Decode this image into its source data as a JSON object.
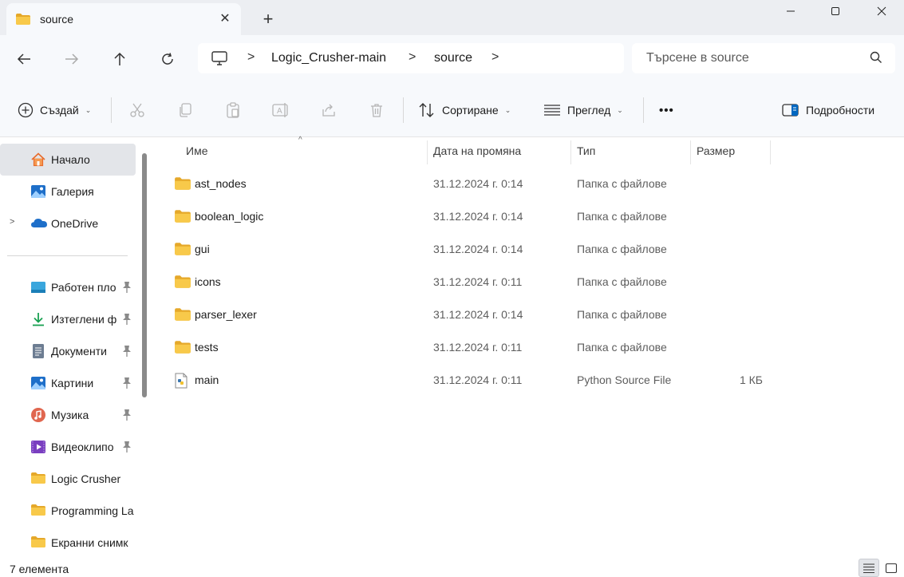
{
  "tab": {
    "title": "source",
    "close_glyph": "✕",
    "new_tab_glyph": "+"
  },
  "window": {
    "minimize_icon": "minimize-icon",
    "maximize_icon": "maximize-icon",
    "close_icon": "close-icon"
  },
  "breadcrumb": {
    "items": [
      "Logic_Crusher-main",
      "source"
    ],
    "separator": ">"
  },
  "search": {
    "placeholder": "Търсене в source"
  },
  "toolbar": {
    "new_label": "Създай",
    "sort_label": "Сортиране",
    "view_label": "Преглед",
    "more_label": "•••",
    "details_label": "Подробности"
  },
  "sidebar": {
    "items": [
      {
        "label": "Начало",
        "icon": "home-icon"
      },
      {
        "label": "Галерия",
        "icon": "gallery-icon"
      },
      {
        "label": "OneDrive",
        "icon": "onedrive-icon"
      },
      {
        "label": "Работен пло",
        "icon": "desktop-icon",
        "pinned": true
      },
      {
        "label": "Изтеглени ф",
        "icon": "download-icon",
        "pinned": true
      },
      {
        "label": "Документи",
        "icon": "documents-icon",
        "pinned": true
      },
      {
        "label": "Картини",
        "icon": "pictures-icon",
        "pinned": true
      },
      {
        "label": "Музика",
        "icon": "music-icon",
        "pinned": true
      },
      {
        "label": "Видеоклипо",
        "icon": "videos-icon",
        "pinned": true
      },
      {
        "label": "Logic Crusher",
        "icon": "folder-icon"
      },
      {
        "label": "Programming La",
        "icon": "folder-icon"
      },
      {
        "label": "Екранни снимк",
        "icon": "folder-icon"
      }
    ],
    "expander_glyph": ">"
  },
  "columns": {
    "name": "Име",
    "date": "Дата на промяна",
    "type": "Тип",
    "size": "Размер",
    "sort_glyph": "^"
  },
  "files": [
    {
      "name": "ast_nodes",
      "date": "31.12.2024 г. 0:14",
      "type": "Папка с файлове",
      "size": "",
      "icon": "folder-icon"
    },
    {
      "name": "boolean_logic",
      "date": "31.12.2024 г. 0:14",
      "type": "Папка с файлове",
      "size": "",
      "icon": "folder-icon"
    },
    {
      "name": "gui",
      "date": "31.12.2024 г. 0:14",
      "type": "Папка с файлове",
      "size": "",
      "icon": "folder-icon"
    },
    {
      "name": "icons",
      "date": "31.12.2024 г. 0:11",
      "type": "Папка с файлове",
      "size": "",
      "icon": "folder-icon"
    },
    {
      "name": "parser_lexer",
      "date": "31.12.2024 г. 0:14",
      "type": "Папка с файлове",
      "size": "",
      "icon": "folder-icon"
    },
    {
      "name": "tests",
      "date": "31.12.2024 г. 0:11",
      "type": "Папка с файлове",
      "size": "",
      "icon": "folder-icon"
    },
    {
      "name": "main",
      "date": "31.12.2024 г. 0:11",
      "type": "Python Source File",
      "size": "1 КБ",
      "icon": "python-file-icon"
    }
  ],
  "status": {
    "item_count": "7 елемента"
  },
  "colors": {
    "accent": "#0067c0",
    "folder": "#f8c94a",
    "folder_dark": "#e5a82a",
    "selection": "#e3e5e9"
  }
}
